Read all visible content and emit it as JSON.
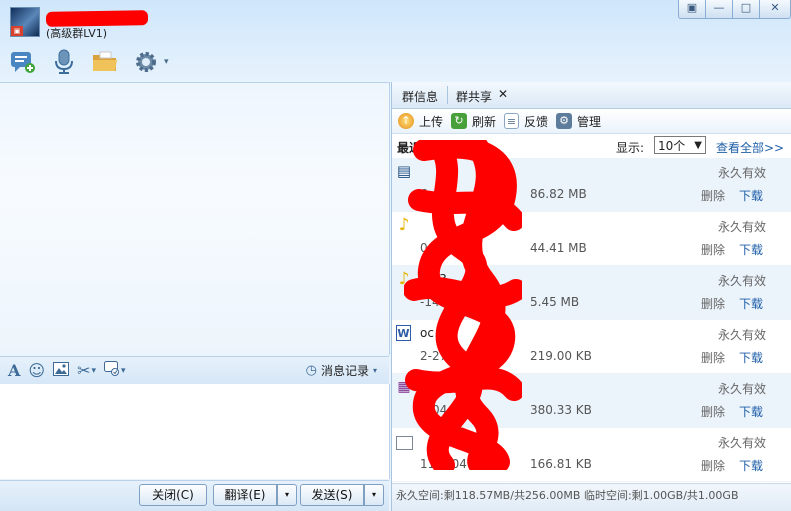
{
  "window": {
    "group_level": "(高级群LV1)",
    "buttons": {
      "restore": "▣",
      "minimize": "—",
      "maximize": "□",
      "close": "✕"
    }
  },
  "toolbar": {
    "icons": [
      "chat-add-icon",
      "microphone-icon",
      "folder-share-icon",
      "gear-icon"
    ],
    "caret": "▾"
  },
  "input_toolbar": {
    "icons": [
      "font-icon",
      "emoji-icon",
      "image-icon",
      "scissors-icon",
      "screen-capture-icon"
    ],
    "history_label": "消息记录",
    "caret": "▾"
  },
  "bottom": {
    "close_label": "关闭(C)",
    "translate_label": "翻译(E)",
    "send_label": "发送(S)",
    "dropdown_arrow": "▾"
  },
  "tabs": [
    {
      "label": "群信息"
    },
    {
      "label": "群共享",
      "close": "✕"
    }
  ],
  "actions": {
    "upload": "上传",
    "refresh": "刷新",
    "feedback": "反馈",
    "manage": "管理"
  },
  "list_header": {
    "recent_label": "最近上传的文件",
    "display_label": "显示:",
    "display_value": "10个",
    "view_all": "查看全部>>"
  },
  "files": [
    {
      "icon": "video-file-icon",
      "name": "",
      "date": "6",
      "size": "86.82 MB",
      "validity": "永久有效",
      "delete": "删除",
      "download": "下载"
    },
    {
      "icon": "music-file-icon",
      "name": "",
      "date": "06",
      "size": "44.41 MB",
      "validity": "永久有效",
      "delete": "删除",
      "download": "下载"
    },
    {
      "icon": "music-file-icon",
      "name": "mp3",
      "date": "-14",
      "size": "5.45 MB",
      "validity": "永久有效",
      "delete": "删除",
      "download": "下载"
    },
    {
      "icon": "word-file-icon",
      "name": "oc",
      "date": "2-27",
      "size": "219.00 KB",
      "validity": "永久有效",
      "delete": "删除",
      "download": "下载"
    },
    {
      "icon": "rar-file-icon",
      "name": "ar",
      "date": "2-04",
      "size": "380.33 KB",
      "validity": "永久有效",
      "delete": "删除",
      "download": "下载"
    },
    {
      "icon": "blank-file-icon",
      "name": "",
      "date": "11-2-04",
      "size": "166.81 KB",
      "validity": "永久有效",
      "delete": "删除",
      "download": "下载"
    }
  ],
  "status": {
    "text": "永久空间:剩118.57MB/共256.00MB 临时空间:剩1.00GB/共1.00GB"
  },
  "colors": {
    "redaction": "#ff0000",
    "link": "#1f5fa8",
    "panel_border": "#a9c4df"
  }
}
